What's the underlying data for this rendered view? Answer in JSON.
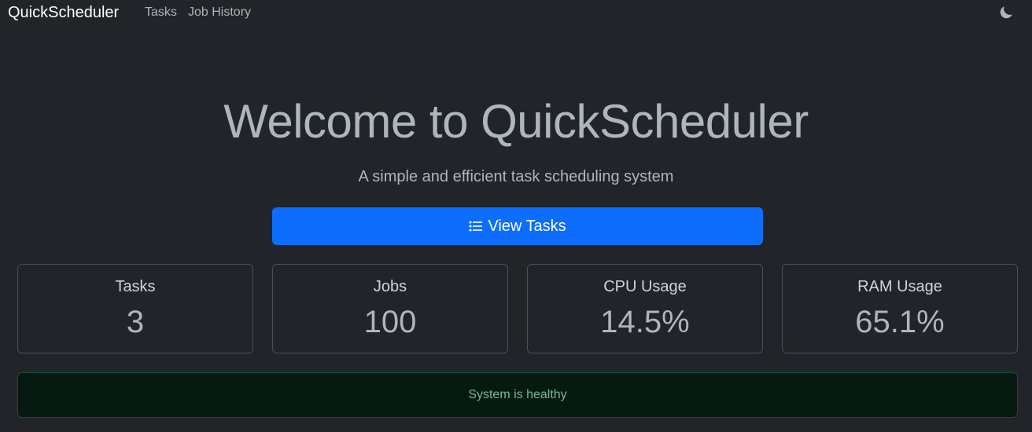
{
  "navbar": {
    "brand": "QuickScheduler",
    "links": [
      {
        "label": "Tasks"
      },
      {
        "label": "Job History"
      }
    ],
    "theme_toggle_icon": "moon-icon"
  },
  "hero": {
    "title": "Welcome to QuickScheduler",
    "subtitle": "A simple and efficient task scheduling system",
    "button": {
      "label": "View Tasks",
      "icon": "list-icon",
      "color": "#0d6efd"
    }
  },
  "stats": [
    {
      "label": "Tasks",
      "value": "3"
    },
    {
      "label": "Jobs",
      "value": "100"
    },
    {
      "label": "CPU Usage",
      "value": "14.5%"
    },
    {
      "label": "RAM Usage",
      "value": "65.1%"
    }
  ],
  "status": {
    "message": "System is healthy",
    "color": "#75b798"
  }
}
